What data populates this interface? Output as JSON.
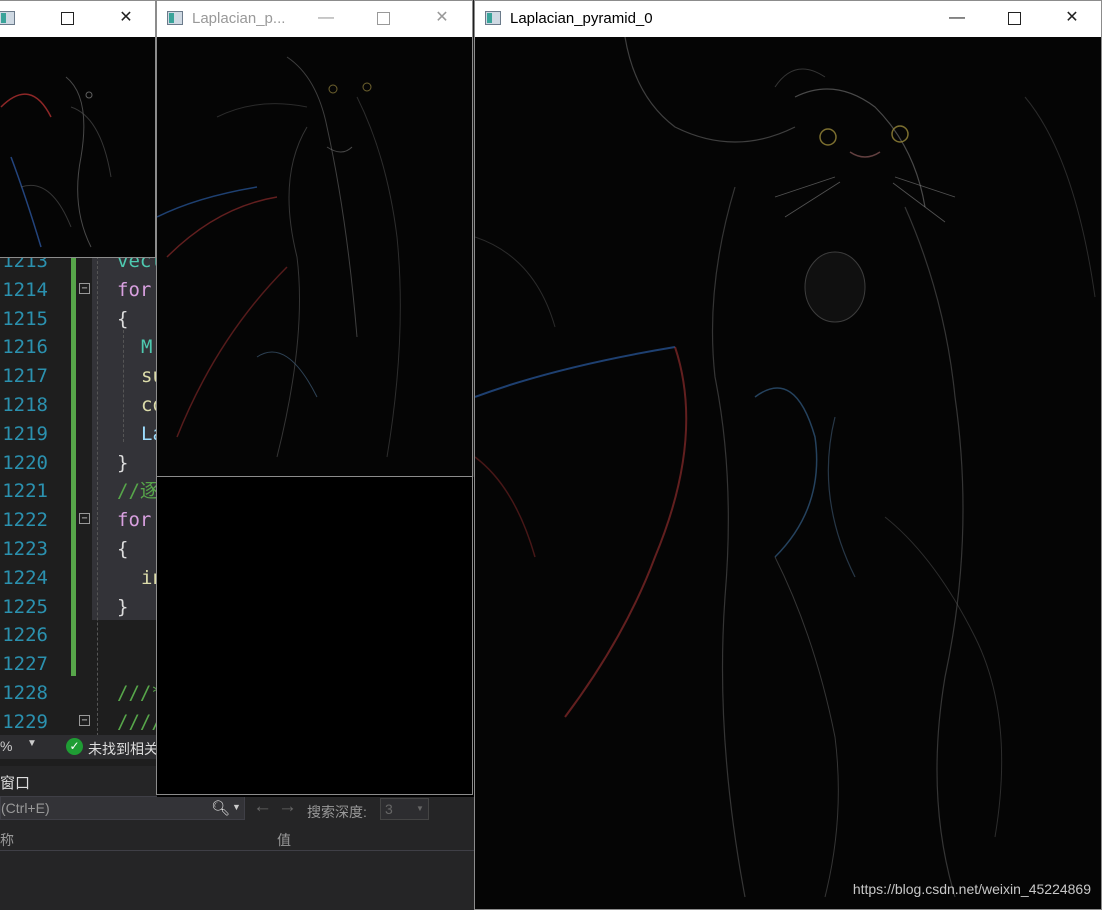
{
  "ide": {
    "lines": [
      {
        "num": "1213",
        "code": "vect",
        "cls": "kw-blue"
      },
      {
        "num": "1214",
        "code": "for (",
        "cls": "kw-pink"
      },
      {
        "num": "1215",
        "code": "{",
        "cls": "plain"
      },
      {
        "num": "1216",
        "code": "M",
        "cls": "kw-blue",
        "indent": true
      },
      {
        "num": "1217",
        "code": "su",
        "cls": "fn",
        "indent": true
      },
      {
        "num": "1218",
        "code": "co",
        "cls": "fn",
        "indent": true
      },
      {
        "num": "1219",
        "code": "La",
        "cls": "ident",
        "indent": true
      },
      {
        "num": "1220",
        "code": "}",
        "cls": "plain"
      },
      {
        "num": "1221",
        "code": "//逐",
        "cls": "comment"
      },
      {
        "num": "1222",
        "code": "for (",
        "cls": "kw-pink"
      },
      {
        "num": "1223",
        "code": "{",
        "cls": "plain"
      },
      {
        "num": "1224",
        "code": "in",
        "cls": "fn",
        "indent": true
      },
      {
        "num": "1225",
        "code": "}",
        "cls": "plain"
      },
      {
        "num": "1226",
        "code": "",
        "cls": "plain"
      },
      {
        "num": "1227",
        "code": "",
        "cls": "plain"
      },
      {
        "num": "1228",
        "code": "///*",
        "cls": "comment"
      },
      {
        "num": "1229",
        "code": "////",
        "cls": "comment"
      }
    ],
    "status": {
      "zoom": "%",
      "issues_text": "未找到相关"
    },
    "panel": {
      "title": "窗口",
      "search_placeholder": "(Ctrl+E)",
      "depth_label": "搜索深度:",
      "depth_value": "3",
      "col_name": "称",
      "col_value": "值"
    }
  },
  "windows": [
    {
      "title": "",
      "minimize": "—",
      "close": "✕"
    },
    {
      "title": "Laplacian_p...",
      "minimize": "—",
      "close": "✕"
    },
    {
      "title": "Laplacian_pyramid_0",
      "minimize": "—",
      "close": "✕"
    }
  ],
  "watermark": "https://blog.csdn.net/weixin_45224869"
}
